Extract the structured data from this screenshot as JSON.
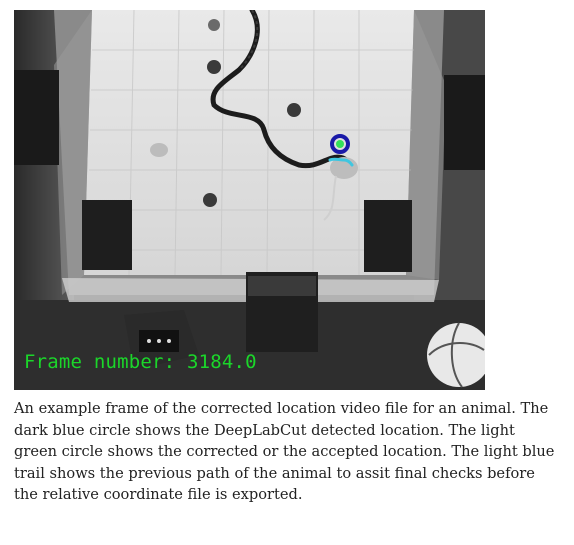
{
  "figure": {
    "frame_label": "Frame number: 3184.0",
    "colors": {
      "frame_label": "#1bd62a",
      "detected_circle": "#1a1aa8",
      "corrected_circle": "#33e05a",
      "trail": "#3fc6e0"
    }
  },
  "caption": {
    "text": "An example frame of the corrected location video file for an animal. The dark blue circle shows the DeepLabCut detected location. The light green circle shows the corrected or the accepted location. The light blue trail shows the previous path of the animal to assit final checks before the relative coordinate file is exported."
  }
}
